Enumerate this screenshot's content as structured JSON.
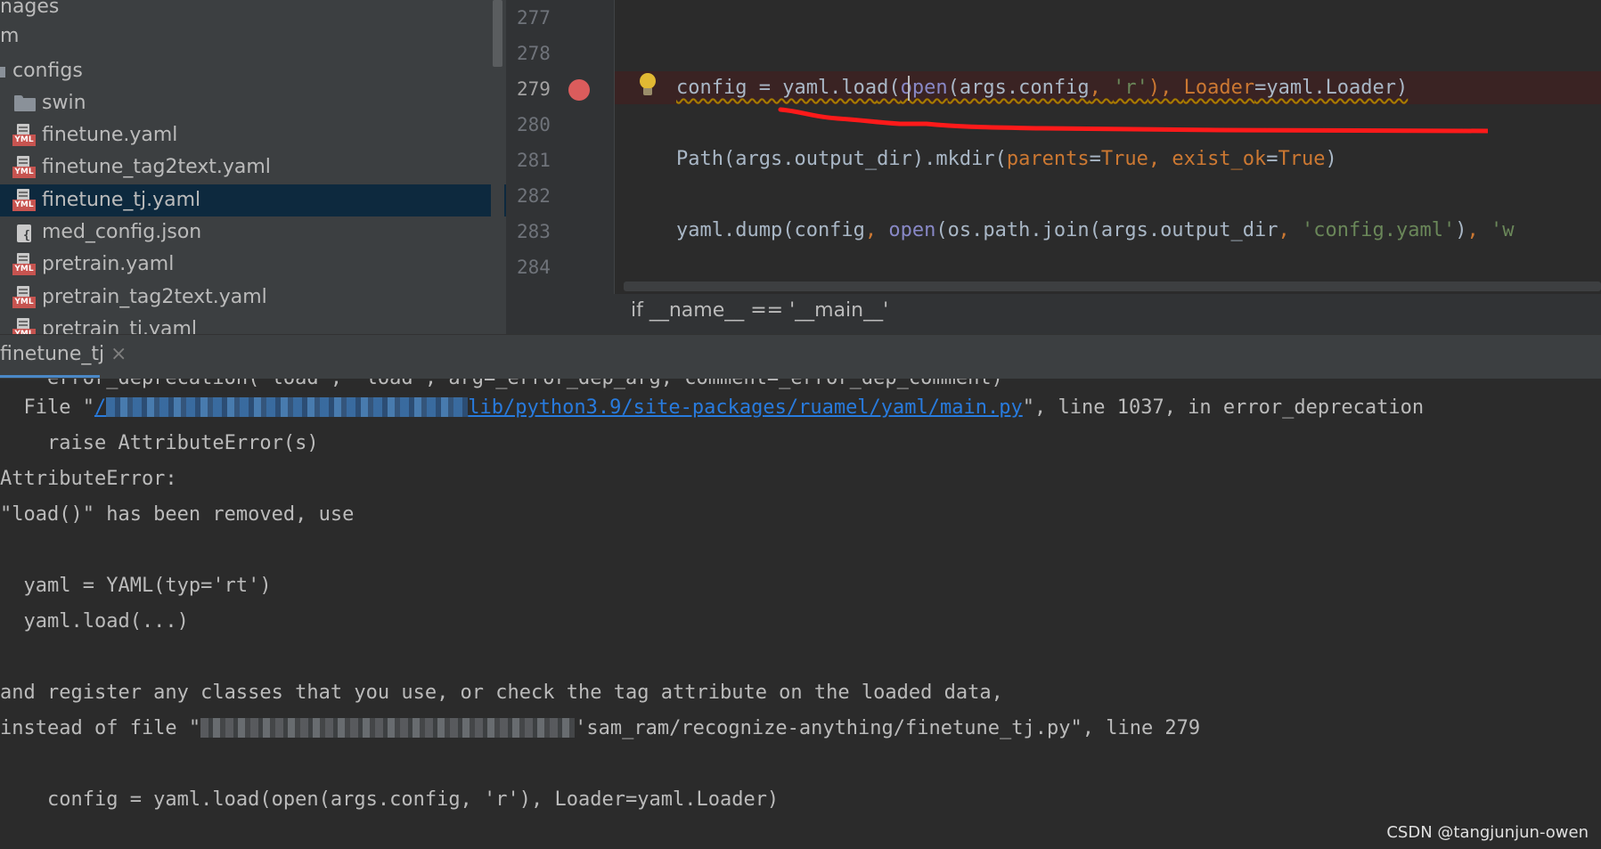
{
  "project_tree": {
    "items": [
      {
        "label": "nages",
        "kind": "folder-partial"
      },
      {
        "label": "m",
        "kind": "folder-partial"
      },
      {
        "label": "configs",
        "kind": "folder-open"
      },
      {
        "label": "swin",
        "kind": "folder"
      },
      {
        "label": "finetune.yaml",
        "kind": "yaml"
      },
      {
        "label": "finetune_tag2text.yaml",
        "kind": "yaml"
      },
      {
        "label": "finetune_tj.yaml",
        "kind": "yaml",
        "selected": true
      },
      {
        "label": "med_config.json",
        "kind": "json"
      },
      {
        "label": "pretrain.yaml",
        "kind": "yaml"
      },
      {
        "label": "pretrain_tag2text.yaml",
        "kind": "yaml"
      },
      {
        "label": "pretrain_tj.yaml",
        "kind": "yaml"
      }
    ],
    "yml_tag": "YML"
  },
  "editor": {
    "line_numbers": [
      "277",
      "278",
      "279",
      "280",
      "281",
      "282",
      "283",
      "284"
    ],
    "current_line": "279",
    "breakpoint_line": "279",
    "lines": {
      "l279": {
        "a": "config = yaml.loa",
        "b": "d(",
        "c": "open",
        "d": "(args.config",
        "e": ", ",
        "f": "'r'",
        "g": "), ",
        "h": "Loader",
        "i": "=yaml.Loader)"
      },
      "l281": {
        "a": "Path(args.output_dir).mkdir(",
        "b": "parents",
        "c": "=",
        "d": "True",
        "e": ", ",
        "f": "exist_ok",
        "g": "=",
        "h": "True",
        "i": ")"
      },
      "l283": {
        "a": "yaml.dump(config",
        "b": ", ",
        "c": "open",
        "d": "(os.path.join(args.output_dir",
        "e": ", ",
        "f": "'config.yaml'",
        "g": ")",
        "h": ", ",
        "i": "'w"
      }
    }
  },
  "breadcrumb": "if __name__ == '__main__'",
  "run_panel": {
    "tab_label": "finetune_tj",
    "close_glyph": "×"
  },
  "console": {
    "line1": "    error_deprecation('load', 'load', arg=_error_dep_arg, comment=_error_dep_comment)",
    "line2_prefix": "  File \"",
    "line2_link_head": "/",
    "line2_link_tail": "lib/python3.9/site-packages/ruamel/yaml/main.py",
    "line2_suffix": "\", line 1037, in error_deprecation",
    "line3": "    raise AttributeError(s)",
    "line4": "AttributeError:",
    "line5": "\"load()\" has been removed, use",
    "line6": "  yaml = YAML(typ='rt')",
    "line7": "  yaml.load(...)",
    "line8": "and register any classes that you use, or check the tag attribute on the loaded data,",
    "line9_prefix": "instead of file \"",
    "line9_suffix": "'sam_ram/recognize-anything/finetune_tj.py\", line 279",
    "line10": "    config = yaml.load(open(args.config, 'r'), Loader=yaml.Loader)"
  },
  "watermark": "CSDN @tangjunjun-owen",
  "colors": {
    "accent_selection": "#0d293e",
    "breakpoint": "#db5c5c",
    "link": "#287bde",
    "annotation_red": "#ff1a1a"
  }
}
